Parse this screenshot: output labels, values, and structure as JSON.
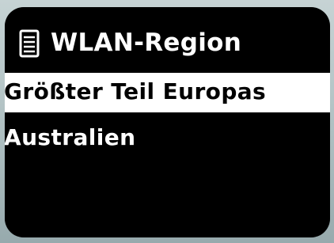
{
  "screen": {
    "title": "WLAN-Region",
    "title_icon": "list-document-icon",
    "menu": [
      {
        "label": "Größter Teil Europas",
        "selected": true
      },
      {
        "label": "Australien",
        "selected": false
      }
    ]
  },
  "colors": {
    "screen_background": "#000000",
    "text": "#ffffff",
    "selection_background": "#ffffff",
    "selection_text": "#000000",
    "bezel": "#b9c8c9"
  }
}
